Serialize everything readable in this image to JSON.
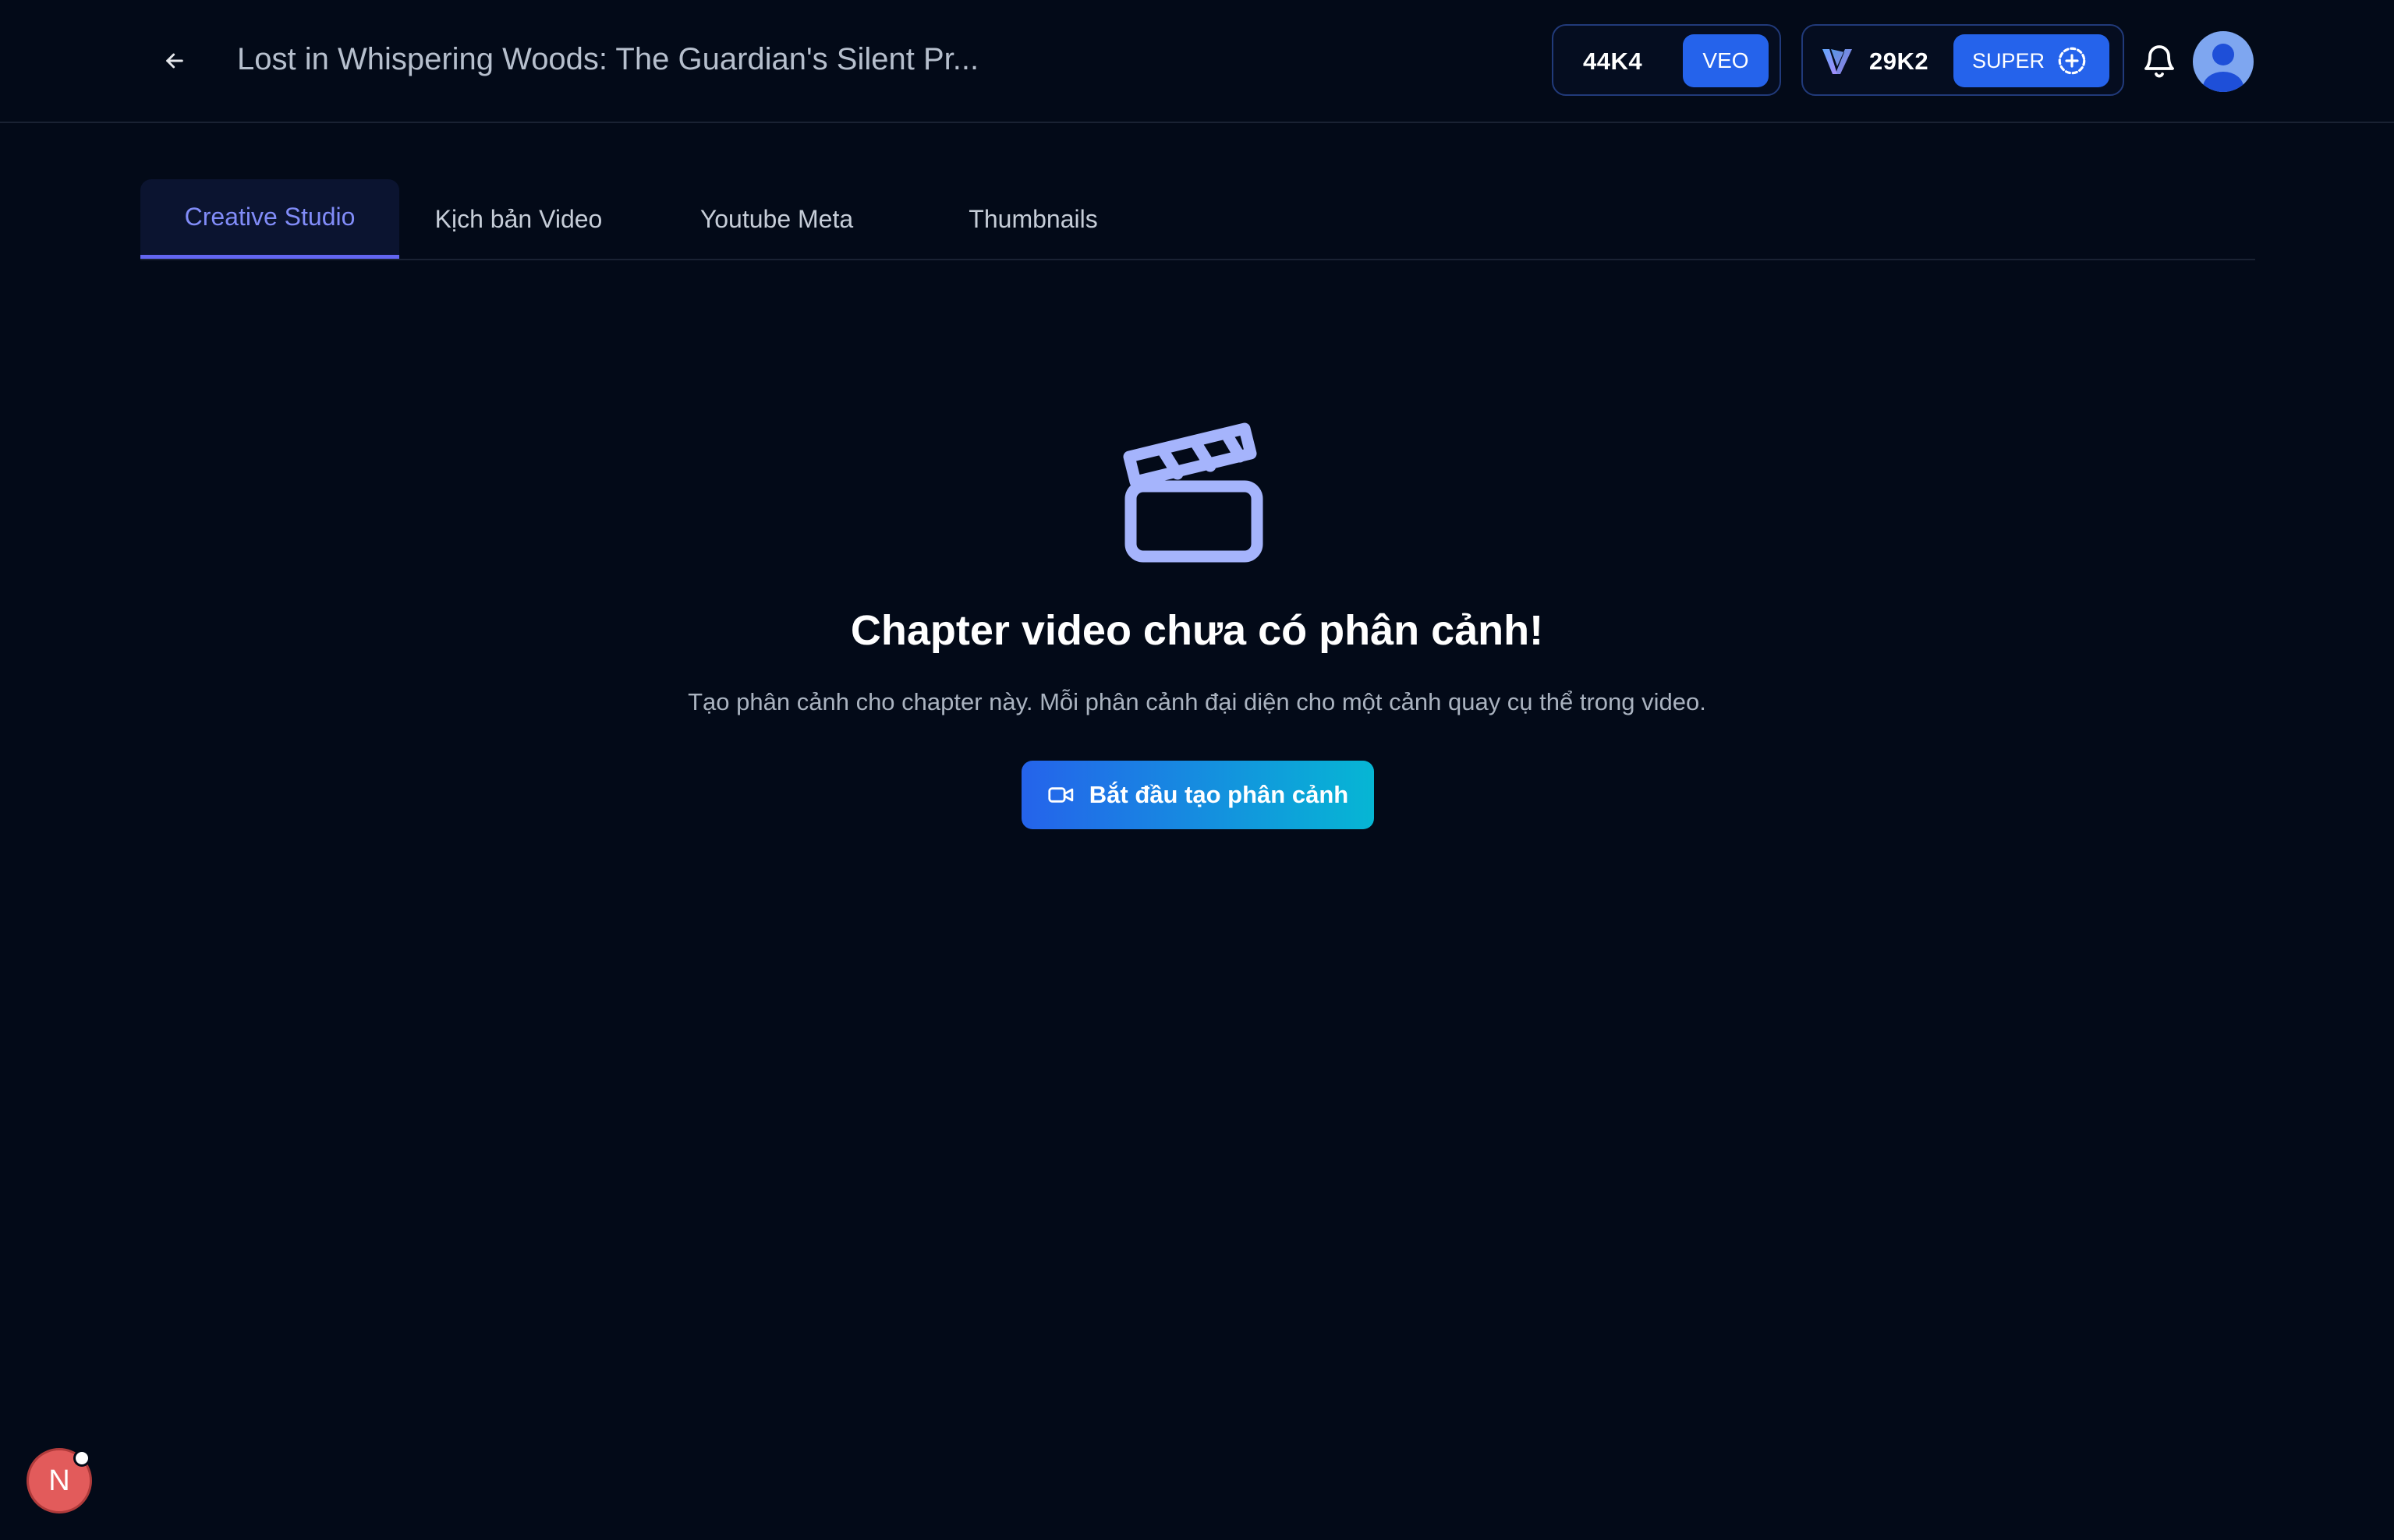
{
  "header": {
    "title": "Lost in Whispering Woods: The Guardian's Silent Pr...",
    "credits_veo": {
      "value": "44K4",
      "badge": "VEO"
    },
    "credits_super": {
      "value": "29K2",
      "badge": "SUPER"
    }
  },
  "tabs": [
    {
      "label": "Creative Studio",
      "active": true
    },
    {
      "label": "Kịch bản Video",
      "active": false
    },
    {
      "label": "Youtube Meta",
      "active": false
    },
    {
      "label": "Thumbnails",
      "active": false
    }
  ],
  "empty_state": {
    "title": "Chapter video chưa có phân cảnh!",
    "description": "Tạo phân cảnh cho chapter này. Mỗi phân cảnh đại diện cho một cảnh quay cụ thể trong video.",
    "button_label": "Bắt đầu tạo phân cảnh"
  },
  "floating_badge": {
    "letter": "N"
  },
  "icons": {
    "back": "arrow-left-icon",
    "brand": "v-logo-icon",
    "add": "plus-circle-icon",
    "notifications": "bell-icon",
    "user": "avatar-icon",
    "empty": "clapperboard-icon",
    "button": "video-camera-icon"
  },
  "colors": {
    "background": "#030a18",
    "accent": "#2563eb",
    "accent_gradient_end": "#06b6d4",
    "tab_active": "#818cf8",
    "icon_lavender": "#a5b4fc",
    "badge_red": "#e25b5b"
  }
}
